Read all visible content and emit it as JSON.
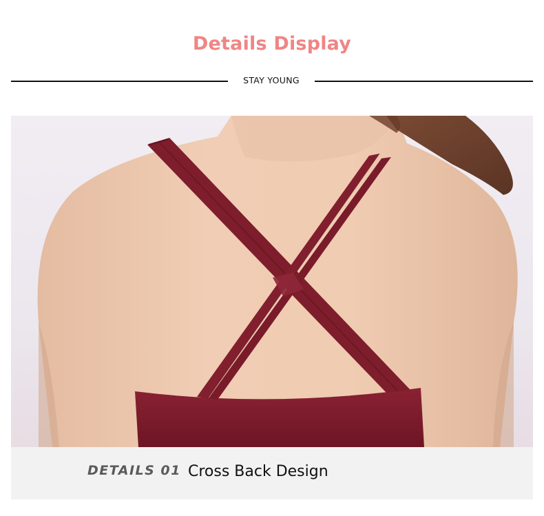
{
  "header": {
    "title": "Details Display",
    "subtitle": "STAY YOUNG"
  },
  "photo": {
    "subject": "back-view-cross-strap-top"
  },
  "caption": {
    "number_label": "DETAILS 01",
    "description": "Cross Back Design"
  },
  "colors": {
    "title": "#f08585",
    "strap": "#7e1d2b",
    "caption_bar": "#f2f2f2"
  }
}
